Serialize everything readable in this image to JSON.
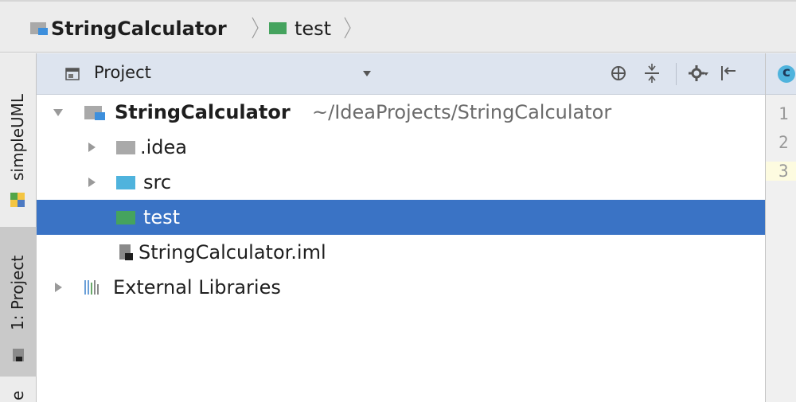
{
  "breadcrumb": {
    "project": "StringCalculator",
    "folder": "test"
  },
  "toolstrip": {
    "simpleuml_label": "simpleUML",
    "project_label": "1: Project",
    "partial_label": "e"
  },
  "panel": {
    "view_label": "Project"
  },
  "tree": {
    "root_name": "StringCalculator",
    "root_path": "~/IdeaProjects/StringCalculator",
    "items": [
      {
        "label": ".idea"
      },
      {
        "label": "src"
      },
      {
        "label": "test"
      },
      {
        "label": "StringCalculator.iml"
      },
      {
        "label": "External Libraries"
      }
    ]
  },
  "editor": {
    "tab_letter": "c",
    "line_numbers": [
      "1",
      "2",
      "3"
    ]
  },
  "colors": {
    "selection": "#3a73c5",
    "header": "#dde4ef",
    "source_folder": "#4fb3dd",
    "test_folder": "#45a35e",
    "plain_folder": "#a9a9a9"
  }
}
